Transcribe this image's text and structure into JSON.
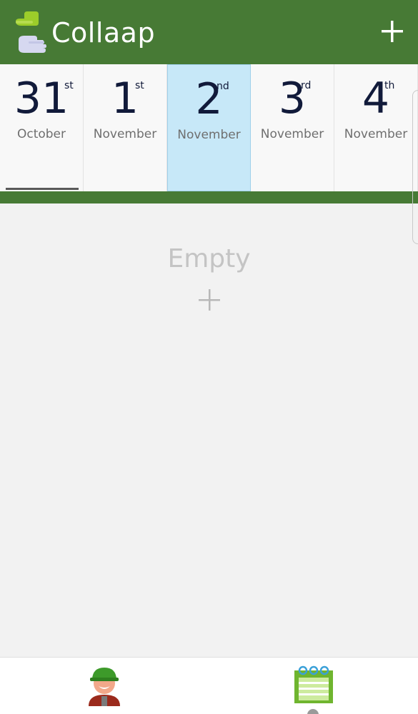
{
  "app_bar": {
    "title": "Collaap",
    "logo_icon": "collaap-hands-logo-icon",
    "add_icon": "plus-icon",
    "background": "#477a35"
  },
  "date_strip": {
    "days": [
      {
        "day": "31",
        "suffix": "st",
        "month": "October",
        "is_today": true,
        "selected": false
      },
      {
        "day": "1",
        "suffix": "st",
        "month": "November",
        "is_today": false,
        "selected": false
      },
      {
        "day": "2",
        "suffix": "nd",
        "month": "November",
        "is_today": false,
        "selected": true
      },
      {
        "day": "3",
        "suffix": "rd",
        "month": "November",
        "is_today": false,
        "selected": false
      },
      {
        "day": "4",
        "suffix": "th",
        "month": "November",
        "is_today": false,
        "selected": false
      }
    ],
    "selected_color": "#c7e8f8"
  },
  "content": {
    "empty_label": "Empty",
    "add_icon": "plus-icon"
  },
  "bottom_nav": {
    "items": [
      {
        "icon": "worker-avatar-icon"
      },
      {
        "icon": "calendar-notepad-icon"
      }
    ]
  }
}
